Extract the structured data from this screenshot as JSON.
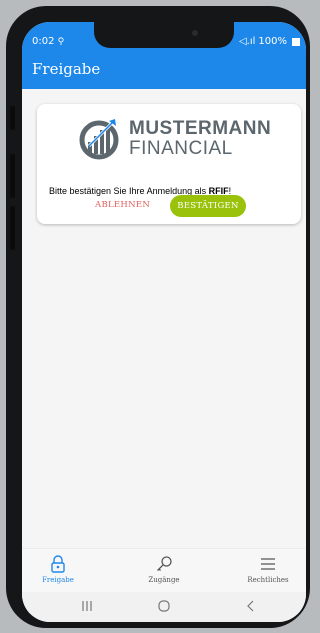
{
  "status_bar": {
    "time": "0:02",
    "activity_icon": "bicycle-icon",
    "signal_text": "◁.ıl",
    "battery_text": "100%"
  },
  "appbar": {
    "title": "Freigabe"
  },
  "card": {
    "logo": {
      "line1": "MUSTERMANN",
      "line2": "FINANCIAL"
    },
    "message_prefix": "Bitte bestätigen Sie Ihre Anmeldung als ",
    "message_user": "RFIF",
    "message_suffix": "!",
    "decline_label": "ABLEHNEN",
    "confirm_label": "BESTÄTIGEN"
  },
  "bottom_nav": {
    "items": [
      {
        "label": "Freigabe",
        "icon": "lock-icon",
        "active": true
      },
      {
        "label": "Zugänge",
        "icon": "key-icon",
        "active": false
      },
      {
        "label": "Rechtliches",
        "icon": "menu-icon",
        "active": false
      }
    ]
  },
  "colors": {
    "accent": "#1e88ea",
    "confirm": "#9ac20a",
    "decline": "#e25d5b",
    "logo_text": "#5c666d"
  }
}
